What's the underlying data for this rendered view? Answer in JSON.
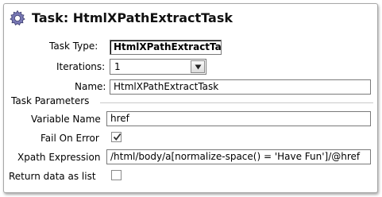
{
  "window": {
    "title": "Task: HtmlXPathExtractTask",
    "icon": "gear-icon"
  },
  "form": {
    "task_type": {
      "label": "Task Type:",
      "value": "HtmlXPathExtractTask"
    },
    "iterations": {
      "label": "Iterations:",
      "value": "1"
    },
    "name": {
      "label": "Name:",
      "value": "HtmlXPathExtractTask"
    }
  },
  "parameters": {
    "section_title": "Task Parameters",
    "variable_name": {
      "label": "Variable Name",
      "value": "href"
    },
    "fail_on_error": {
      "label": "Fail On Error",
      "checked": true
    },
    "xpath_expression": {
      "label": "Xpath Expression",
      "value": "/html/body/a[normalize-space() = 'Have Fun']/@href"
    },
    "return_data_as_list": {
      "label": "Return data as list",
      "checked": false
    }
  },
  "colors": {
    "border": "#a8a8a8",
    "gear": "#6a6aa8",
    "check": "#333333"
  }
}
